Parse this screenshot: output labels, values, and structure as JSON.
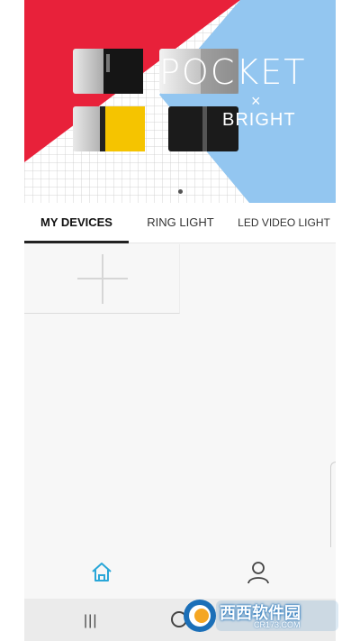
{
  "banner": {
    "title": "POCKET",
    "x_mark": "×",
    "subtitle": "BRIGHT",
    "page_indicator": "•",
    "colors": {
      "red": "#e8213a",
      "blue": "#93c6f0",
      "yellow": "#f5c400"
    }
  },
  "tabs": [
    {
      "label": "MY DEVICES",
      "active": true
    },
    {
      "label": "RING LIGHT",
      "active": false
    },
    {
      "label": "LED VIDEO LIGHT",
      "active": false
    }
  ],
  "devices": {
    "add_icon": "plus-icon"
  },
  "bottom_nav": {
    "home_icon": "home-icon",
    "profile_icon": "person-icon",
    "accent": "#2aa7d8"
  },
  "system_bar": {
    "recent_glyph": "|||"
  },
  "watermark": {
    "text": "西西软件园",
    "sub": "CR173.COM"
  }
}
